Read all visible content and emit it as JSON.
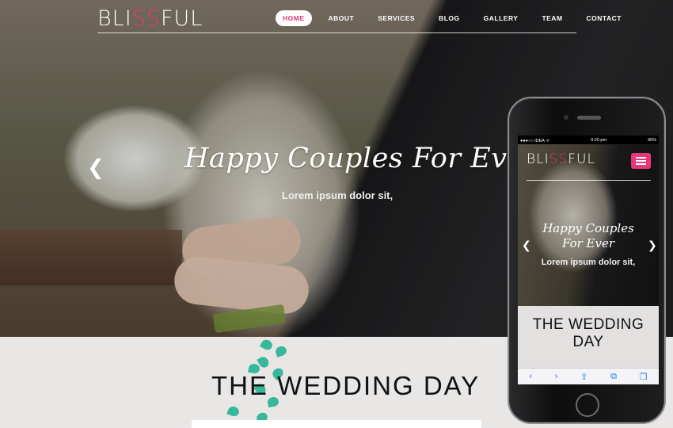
{
  "site": {
    "brand_pre": "BLI",
    "brand_mid": "SS",
    "brand_post": "FUL",
    "accent": "#e8367a"
  },
  "nav": {
    "items": [
      {
        "label": "HOME",
        "active": true
      },
      {
        "label": "ABOUT"
      },
      {
        "label": "SERVICES"
      },
      {
        "label": "BLOG"
      },
      {
        "label": "GALLERY"
      },
      {
        "label": "TEAM"
      },
      {
        "label": "CONTACT"
      }
    ]
  },
  "hero": {
    "title": "Happy Couples For Ever",
    "subtitle": "Lorem ipsum dolor sit,",
    "prev_icon": "chevron-left-icon"
  },
  "section": {
    "title": "THE WEDDING DAY"
  },
  "mobile": {
    "status": {
      "carrier": "●●●○○ IDEA ᯤ",
      "time": "9:20 pm",
      "battery": "90%"
    },
    "title_line1": "Happy Couples",
    "title_line2": "For Ever",
    "subtitle": "Lorem ipsum dolor sit,",
    "section_line1": "THE WEDDING",
    "section_line2": "DAY",
    "toolbar": [
      "‹",
      "›",
      "⇪",
      "⧉",
      "❐"
    ]
  }
}
